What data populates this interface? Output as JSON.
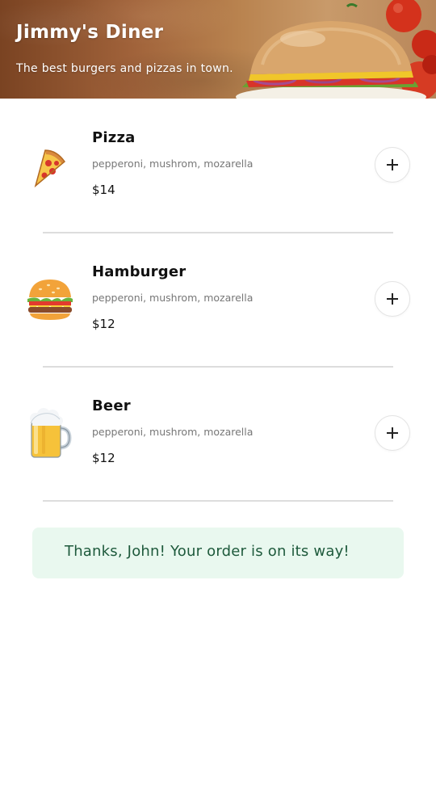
{
  "header": {
    "title": "Jimmy's Diner",
    "subtitle": "The best burgers and pizzas in town."
  },
  "menu": {
    "items": [
      {
        "name": "Pizza",
        "description": "pepperoni, mushrom, mozarella",
        "price": "$14",
        "icon": "pizza-icon"
      },
      {
        "name": "Hamburger",
        "description": "pepperoni, mushrom, mozarella",
        "price": "$12",
        "icon": "hamburger-icon"
      },
      {
        "name": "Beer",
        "description": "pepperoni, mushrom, mozarella",
        "price": "$12",
        "icon": "beer-icon"
      }
    ]
  },
  "confirmation": {
    "message": "Thanks, John! Your order is on its way!"
  },
  "colors": {
    "confirmation_bg": "#e9f8ef",
    "confirmation_text": "#1e5a3c",
    "divider": "#dddddd"
  }
}
